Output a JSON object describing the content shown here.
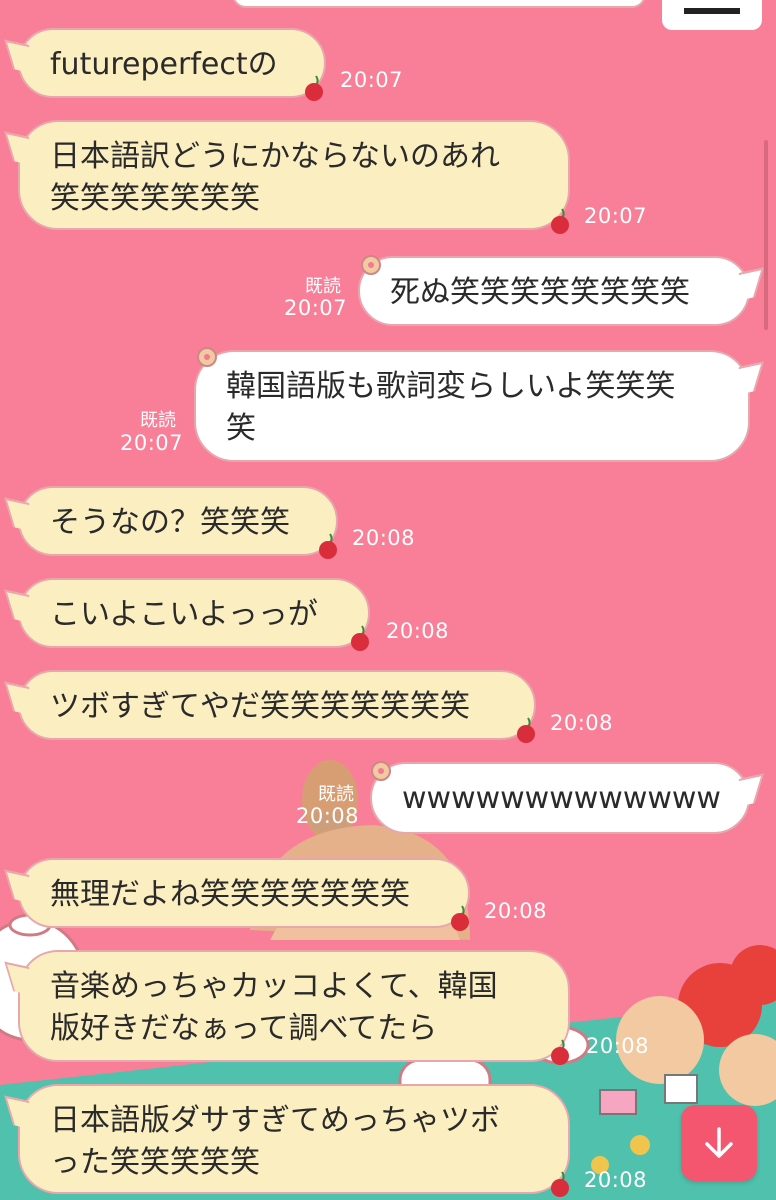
{
  "messages": [
    {
      "side": "in",
      "text": "futureperfectの",
      "time": "20:07"
    },
    {
      "side": "in",
      "text": "日本語訳どうにかならないのあれ\n笑笑笑笑笑笑笑",
      "time": "20:07"
    },
    {
      "side": "out",
      "text": "死ぬ笑笑笑笑笑笑笑笑",
      "time": "20:07",
      "read": "既読"
    },
    {
      "side": "out",
      "text": "韓国語版も歌詞変らしいよ笑笑笑\n笑",
      "time": "20:07",
      "read": "既読"
    },
    {
      "side": "in",
      "text": "そうなの？笑笑笑",
      "time": "20:08"
    },
    {
      "side": "in",
      "text": "こいよこいよっっが",
      "time": "20:08"
    },
    {
      "side": "in",
      "text": "ツボすぎてやだ笑笑笑笑笑笑笑",
      "time": "20:08"
    },
    {
      "side": "out",
      "text": "wwwwwwwwwwwww",
      "time": "20:08",
      "read": "既読"
    },
    {
      "side": "in",
      "text": "無理だよね笑笑笑笑笑笑笑",
      "time": "20:08"
    },
    {
      "side": "in",
      "text": "音楽めっちゃカッコよくて、韓国\n版好きだなぁって調べてたら",
      "time": "20:08"
    },
    {
      "side": "in",
      "text": "日本語版ダサすぎてめっちゃツボ\nった笑笑笑笑笑",
      "time": "20:08"
    }
  ],
  "icons": {
    "cherry": "cherry-icon",
    "flower": "flower-icon",
    "down": "arrow-down-icon"
  },
  "colors": {
    "background": "#f97f98",
    "incoming": "#fbeec0",
    "outgoing": "#ffffff",
    "button": "#f4566f"
  }
}
